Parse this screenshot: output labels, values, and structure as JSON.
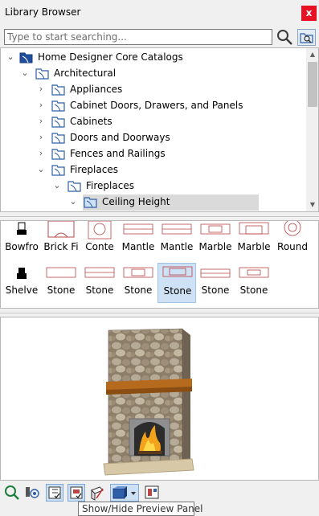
{
  "window": {
    "title": "Library Browser",
    "close_label": "x"
  },
  "search": {
    "placeholder": "Type to start searching...",
    "value": ""
  },
  "tree": {
    "items": [
      {
        "label": "Home Designer Core Catalogs",
        "expanded": true,
        "icon": "catalog-folder-icon"
      },
      {
        "label": "Architectural",
        "expanded": true,
        "icon": "library-folder-icon"
      },
      {
        "label": "Appliances",
        "expanded": false,
        "icon": "library-folder-icon"
      },
      {
        "label": "Cabinet Doors, Drawers, and Panels",
        "expanded": false,
        "icon": "library-folder-icon"
      },
      {
        "label": "Cabinets",
        "expanded": false,
        "icon": "library-folder-icon"
      },
      {
        "label": "Doors and Doorways",
        "expanded": false,
        "icon": "library-folder-icon"
      },
      {
        "label": "Fences and Railings",
        "expanded": false,
        "icon": "library-folder-icon"
      },
      {
        "label": "Fireplaces",
        "expanded": true,
        "icon": "library-folder-icon"
      },
      {
        "label": "Fireplaces",
        "expanded": true,
        "icon": "library-folder-icon"
      },
      {
        "label": "Ceiling Height",
        "expanded": true,
        "icon": "library-folder-icon",
        "selected": true
      }
    ]
  },
  "grid": {
    "items": [
      {
        "label": "Bowfro"
      },
      {
        "label": "Brick Fi"
      },
      {
        "label": "Conte"
      },
      {
        "label": "Mantle"
      },
      {
        "label": "Mantle"
      },
      {
        "label": "Marble"
      },
      {
        "label": "Marble"
      },
      {
        "label": "Round"
      },
      {
        "label": "Shelve"
      },
      {
        "label": "Stone"
      },
      {
        "label": "Stone"
      },
      {
        "label": "Stone"
      },
      {
        "label": "Stone",
        "selected": true
      },
      {
        "label": "Stone"
      },
      {
        "label": "Stone"
      }
    ]
  },
  "toolbar": {
    "buttons": [
      {
        "icon": "search-library-icon"
      },
      {
        "icon": "options-icon"
      },
      {
        "icon": "show-hide-tree-icon",
        "active": true
      },
      {
        "icon": "show-hide-preview-icon",
        "active": true
      },
      {
        "icon": "view-mode-icon"
      },
      {
        "icon": "preview-style-icon",
        "active": true
      },
      {
        "icon": "layout-icon"
      }
    ],
    "tooltip": "Show/Hide Preview Panel"
  },
  "colors": {
    "accent": "#cce0f6",
    "close": "#e81123",
    "folder": "#1f4e9e"
  }
}
